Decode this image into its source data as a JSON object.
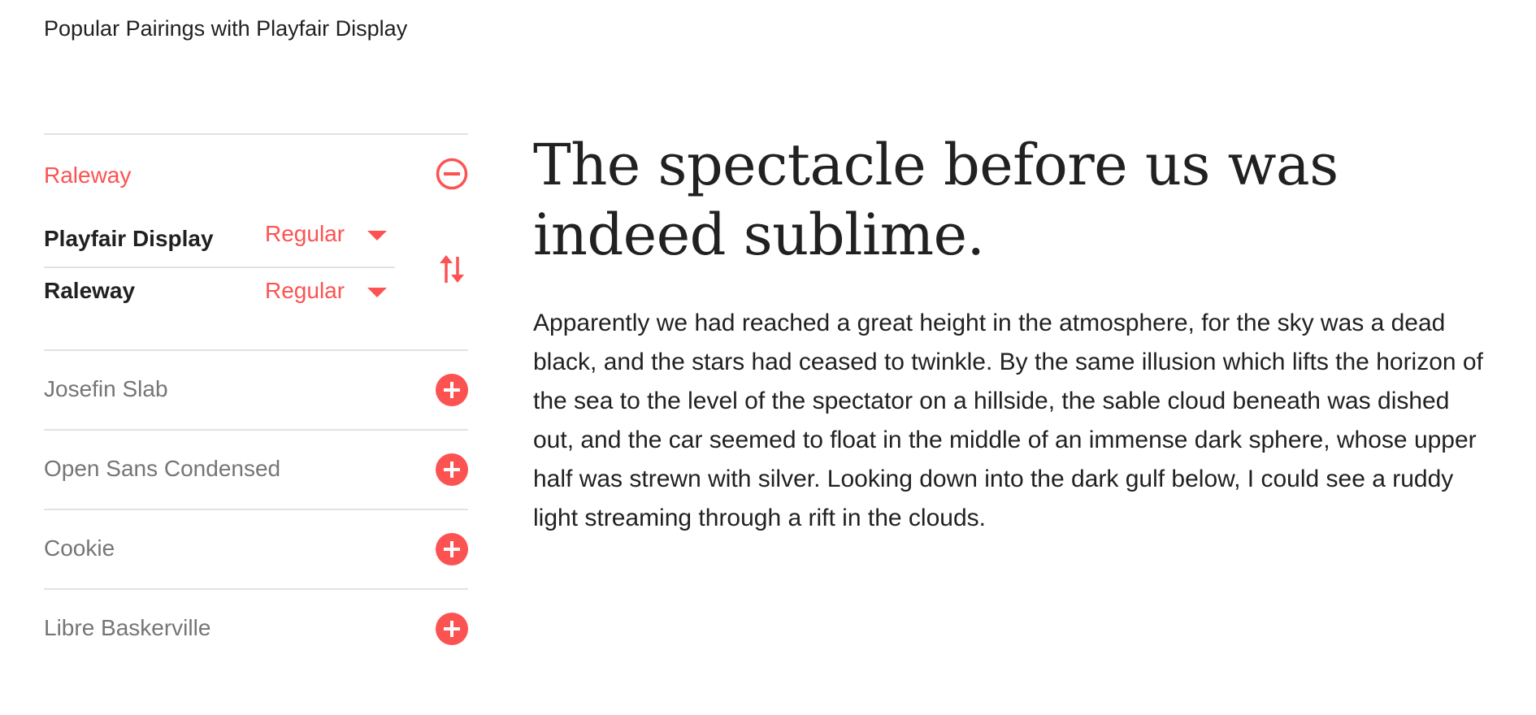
{
  "header": {
    "title": "Popular Pairings with Playfair Display"
  },
  "active_pairing": {
    "name": "Raleway",
    "remove_icon": "minus-circle-icon",
    "swap_icon": "swap-vertical-icon",
    "fonts": [
      {
        "name": "Playfair Display",
        "weight": "Regular"
      },
      {
        "name": "Raleway",
        "weight": "Regular"
      }
    ]
  },
  "pairings": [
    {
      "name": "Josefin Slab",
      "icon": "plus-circle-icon"
    },
    {
      "name": "Open Sans Condensed",
      "icon": "plus-circle-icon"
    },
    {
      "name": "Cookie",
      "icon": "plus-circle-icon"
    },
    {
      "name": "Libre Baskerville",
      "icon": "plus-circle-icon"
    }
  ],
  "preview": {
    "heading": "The spectacle before us was indeed sublime.",
    "body": "Apparently we had reached a great height in the atmosphere, for the sky was a dead black, and the stars had ceased to twinkle. By the same illusion which lifts the horizon of the sea to the level of the spectator on a hillside, the sable cloud beneath was dished out, and the car seemed to float in the middle of an immense dark sphere, whose upper half was strewn with silver. Looking down into the dark gulf below, I could see a ruddy light streaming through a rift in the clouds."
  },
  "colors": {
    "accent": "#fd5252",
    "text": "#212121",
    "muted": "#757575",
    "divider": "#e2e2e2"
  }
}
